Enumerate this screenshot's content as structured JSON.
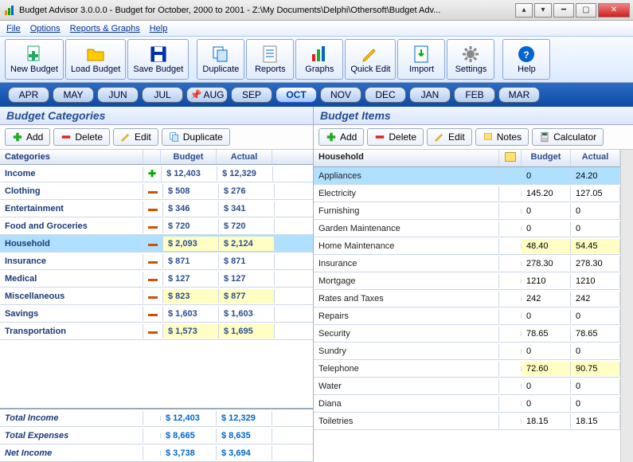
{
  "window": {
    "title": "Budget Advisor 3.0.0.0 -   Budget for October, 2000 to 2001  -  Z:\\My Documents\\Delphi\\Othersoft\\Budget Adv..."
  },
  "menu": [
    "File",
    "Options",
    "Reports & Graphs",
    "Help"
  ],
  "toolbar": [
    {
      "id": "new-budget",
      "label": "New Budget",
      "icon": "file-plus"
    },
    {
      "id": "load-budget",
      "label": "Load Budget",
      "icon": "folder-open"
    },
    {
      "id": "save-budget",
      "label": "Save Budget",
      "icon": "floppy"
    },
    {
      "id": "sep"
    },
    {
      "id": "duplicate",
      "label": "Duplicate",
      "icon": "duplicate"
    },
    {
      "id": "reports",
      "label": "Reports",
      "icon": "reports"
    },
    {
      "id": "graphs",
      "label": "Graphs",
      "icon": "bars"
    },
    {
      "id": "quick-edit",
      "label": "Quick Edit",
      "icon": "pencil"
    },
    {
      "id": "import",
      "label": "Import",
      "icon": "import"
    },
    {
      "id": "settings",
      "label": "Settings",
      "icon": "gear"
    },
    {
      "id": "sep"
    },
    {
      "id": "help",
      "label": "Help",
      "icon": "help"
    }
  ],
  "months": [
    {
      "label": "APR"
    },
    {
      "label": "MAY"
    },
    {
      "label": "JUN"
    },
    {
      "label": "JUL"
    },
    {
      "label": "AUG",
      "pinned": true
    },
    {
      "label": "SEP"
    },
    {
      "label": "OCT",
      "active": true
    },
    {
      "label": "NOV"
    },
    {
      "label": "DEC"
    },
    {
      "label": "JAN"
    },
    {
      "label": "FEB"
    },
    {
      "label": "MAR"
    }
  ],
  "leftPane": {
    "title": "Budget Categories",
    "buttons": [
      {
        "id": "add",
        "label": "Add",
        "icon": "plus"
      },
      {
        "id": "delete",
        "label": "Delete",
        "icon": "minus"
      },
      {
        "id": "edit",
        "label": "Edit",
        "icon": "pencil"
      },
      {
        "id": "duplicate",
        "label": "Duplicate",
        "icon": "duplicate"
      }
    ],
    "headers": {
      "name": "Categories",
      "budget": "Budget",
      "actual": "Actual"
    },
    "rows": [
      {
        "name": "Income",
        "ind": "plus",
        "budget": "$ 12,403",
        "actual": "$ 12,329"
      },
      {
        "name": "Clothing",
        "ind": "minus",
        "budget": "$ 508",
        "actual": "$ 276"
      },
      {
        "name": "Entertainment",
        "ind": "minus",
        "budget": "$ 346",
        "actual": "$ 341"
      },
      {
        "name": "Food and Groceries",
        "ind": "minus",
        "budget": "$ 720",
        "actual": "$ 720"
      },
      {
        "name": "Household",
        "ind": "minus",
        "budget": "$ 2,093",
        "actual": "$ 2,124",
        "selected": true,
        "yellow": true
      },
      {
        "name": "Insurance",
        "ind": "minus",
        "budget": "$ 871",
        "actual": "$ 871"
      },
      {
        "name": "Medical",
        "ind": "minus",
        "budget": "$ 127",
        "actual": "$ 127"
      },
      {
        "name": "Miscellaneous",
        "ind": "minus",
        "budget": "$ 823",
        "actual": "$ 877",
        "yellow": true
      },
      {
        "name": "Savings",
        "ind": "minus",
        "budget": "$ 1,603",
        "actual": "$ 1,603"
      },
      {
        "name": "Transportation",
        "ind": "minus",
        "budget": "$ 1,573",
        "actual": "$ 1,695",
        "yellow": true
      }
    ],
    "totals": [
      {
        "name": "Total Income",
        "budget": "$ 12,403",
        "actual": "$ 12,329"
      },
      {
        "name": "Total Expenses",
        "budget": "$ 8,665",
        "actual": "$ 8,635"
      },
      {
        "name": "Net Income",
        "budget": "$ 3,738",
        "actual": "$ 3,694"
      }
    ]
  },
  "rightPane": {
    "title": "Budget Items",
    "buttons": [
      {
        "id": "add",
        "label": "Add",
        "icon": "plus"
      },
      {
        "id": "delete",
        "label": "Delete",
        "icon": "minus"
      },
      {
        "id": "edit",
        "label": "Edit",
        "icon": "pencil"
      },
      {
        "id": "notes",
        "label": "Notes",
        "icon": "note"
      },
      {
        "id": "calculator",
        "label": "Calculator",
        "icon": "calc"
      }
    ],
    "headers": {
      "name": "Household",
      "budget": "Budget",
      "actual": "Actual"
    },
    "rows": [
      {
        "name": "Appliances",
        "budget": "0",
        "actual": "24.20",
        "selected": true
      },
      {
        "name": "Electricity",
        "budget": "145.20",
        "actual": "127.05"
      },
      {
        "name": "Furnishing",
        "budget": "0",
        "actual": "0"
      },
      {
        "name": "Garden Maintenance",
        "budget": "0",
        "actual": "0"
      },
      {
        "name": "Home Maintenance",
        "budget": "48.40",
        "actual": "54.45",
        "yellow": true
      },
      {
        "name": "Insurance",
        "budget": "278.30",
        "actual": "278.30"
      },
      {
        "name": "Mortgage",
        "budget": "1210",
        "actual": "1210"
      },
      {
        "name": "Rates and Taxes",
        "budget": "242",
        "actual": "242"
      },
      {
        "name": "Repairs",
        "budget": "0",
        "actual": "0"
      },
      {
        "name": "Security",
        "budget": "78.65",
        "actual": "78.65"
      },
      {
        "name": "Sundry",
        "budget": "0",
        "actual": "0"
      },
      {
        "name": "Telephone",
        "budget": "72.60",
        "actual": "90.75",
        "yellow": true
      },
      {
        "name": "Water",
        "budget": "0",
        "actual": "0"
      },
      {
        "name": "Diana",
        "budget": "0",
        "actual": "0"
      },
      {
        "name": "Toiletries",
        "budget": "18.15",
        "actual": "18.15"
      }
    ]
  }
}
